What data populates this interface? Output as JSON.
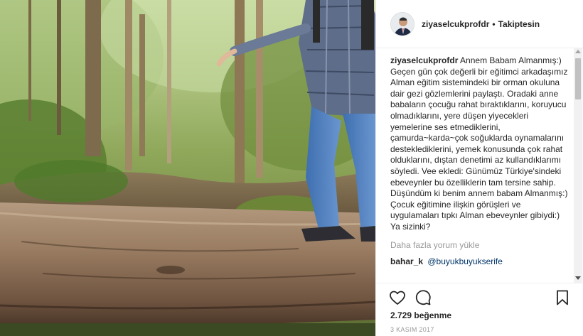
{
  "post": {
    "header": {
      "username": "ziyaselcukprofdr",
      "separator": "•",
      "follow_state": "Takiptesin"
    },
    "caption": {
      "username": "ziyaselcukprofdr",
      "text": "Annem Babam Almanmış:)\nGeçen gün çok değerli bir eğitimci arkadaşımız Alman eğitim sistemindeki bir orman okuluna dair gezi gözlemlerini paylaştı. Oradaki anne babaların çocuğu rahat bıraktıklarını, koruyucu olmadıklarını, yere düşen yiyecekleri yemelerine ses etmediklerini, çamurda~karda~çok soğuklarda oynamalarını desteklediklerini, yemek konusunda çok rahat olduklarını, dıştan denetimi az kullandıklarımı söyledi. Vee ekledi: Günümüz Türkiye'sindeki ebeveynler bu özelliklerin tam tersine sahip. Düşündüm ki benim annem babam Almanmış:) Çocuk eğitimine ilişkin görüşleri ve uygulamaları tıpkı Alman ebeveynler gibiydi:) Ya sizinki?"
    },
    "load_more_label": "Daha fazla yorum yükle",
    "next_comment": {
      "username": "bahar_k",
      "mention": "@buyukbuyukserife"
    },
    "likes_label": "2.729 beğenme",
    "date_label": "3 KASIM 2017",
    "icons": {
      "like": "heart-icon",
      "comment": "speech-bubble-icon",
      "save": "bookmark-icon"
    },
    "colors": {
      "text": "#262626",
      "muted": "#999999",
      "border": "#efefef",
      "link": "#003569"
    }
  }
}
